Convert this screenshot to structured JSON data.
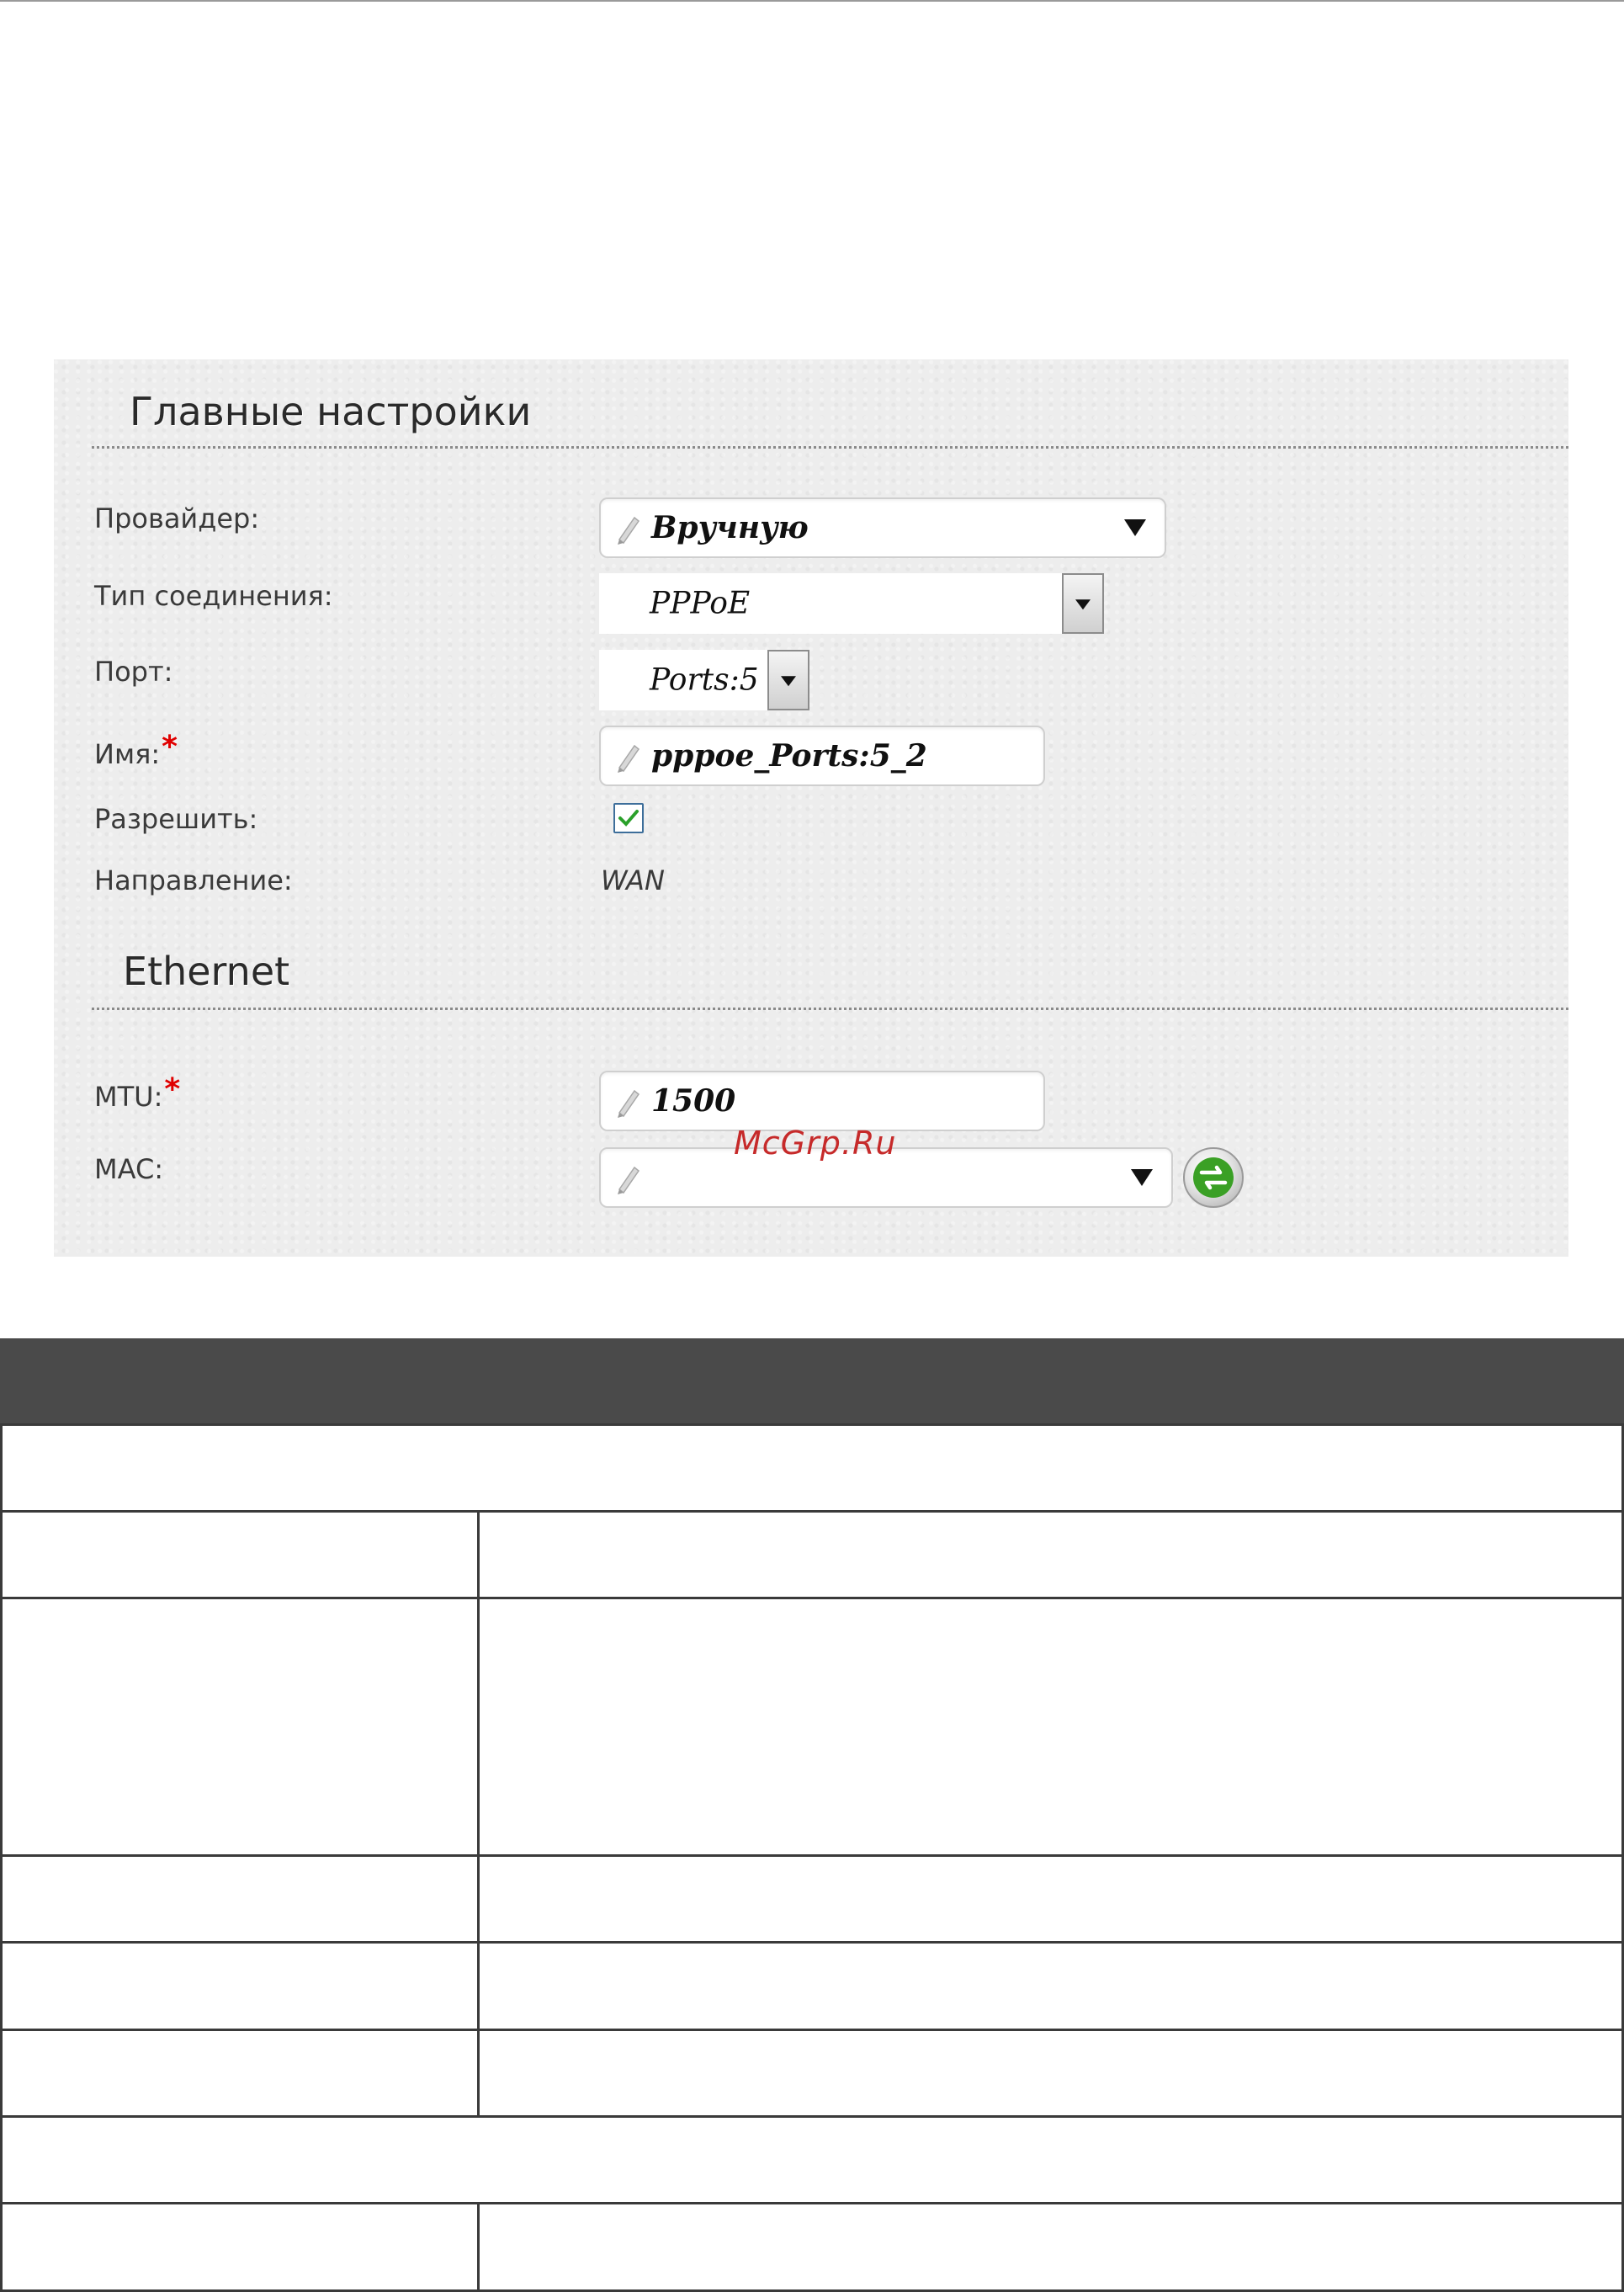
{
  "watermark": "McGrp.Ru",
  "main_settings": {
    "title": "Главные настройки",
    "provider": {
      "label": "Провайдер:",
      "value": "Вручную"
    },
    "connection_type": {
      "label": "Тип соединения:",
      "value": "PPPoE"
    },
    "port": {
      "label": "Порт:",
      "value": "Ports:5"
    },
    "name": {
      "label": "Имя:",
      "required_mark": "*",
      "value": "pppoe_Ports:5_2"
    },
    "enable": {
      "label": "Разрешить:",
      "checked": true
    },
    "direction": {
      "label": "Направление:",
      "value": "WAN"
    }
  },
  "ethernet": {
    "title": "Ethernet",
    "mtu": {
      "label": "MTU:",
      "required_mark": "*",
      "value": "1500"
    },
    "mac": {
      "label": "MAC:",
      "value": ""
    }
  },
  "colors": {
    "panel_bg": "#ededed",
    "required": "#e00000",
    "table_header": "#4a4a4a",
    "checkmark": "#2aa02a",
    "refresh_arrows": "#3aa025"
  }
}
